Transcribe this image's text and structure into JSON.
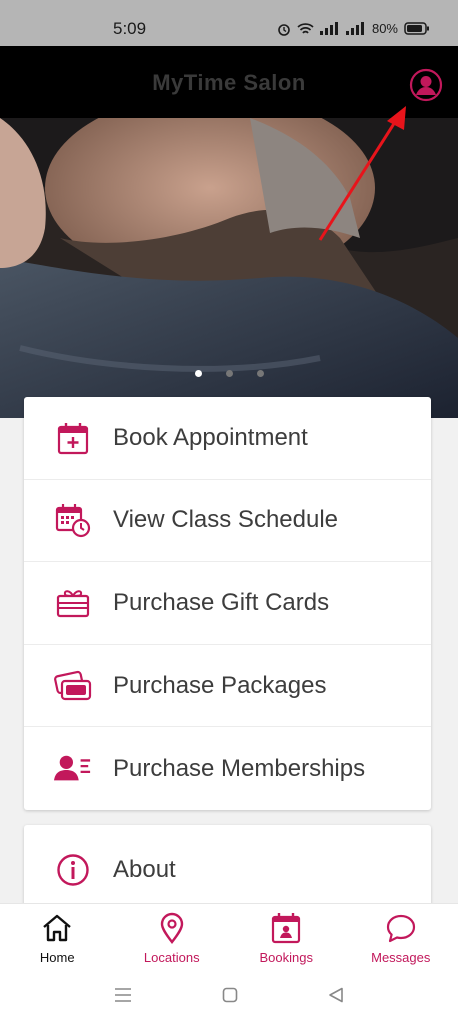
{
  "status_bar": {
    "time": "5:09",
    "battery": "80%"
  },
  "header": {
    "title": "MyTime Salon"
  },
  "carousel": {
    "slides": 3,
    "active_index": 0
  },
  "menu": {
    "items": [
      {
        "label": "Book Appointment",
        "icon": "calendar-plus-icon"
      },
      {
        "label": "View Class Schedule",
        "icon": "calendar-clock-icon"
      },
      {
        "label": "Purchase Gift Cards",
        "icon": "gift-card-icon"
      },
      {
        "label": "Purchase Packages",
        "icon": "cards-icon"
      },
      {
        "label": "Purchase Memberships",
        "icon": "member-icon"
      }
    ],
    "about": {
      "label": "About",
      "icon": "info-icon"
    }
  },
  "bottom_nav": {
    "items": [
      {
        "label": "Home",
        "icon": "home-icon",
        "active": true
      },
      {
        "label": "Locations",
        "icon": "location-pin-icon",
        "active": false
      },
      {
        "label": "Bookings",
        "icon": "bookings-calendar-icon",
        "active": false
      },
      {
        "label": "Messages",
        "icon": "chat-bubble-icon",
        "active": false
      }
    ]
  },
  "colors": {
    "accent": "#c2185b",
    "header_bg": "#000000",
    "status_bg": "#b5b5b5",
    "arrow": "#e8141b"
  }
}
